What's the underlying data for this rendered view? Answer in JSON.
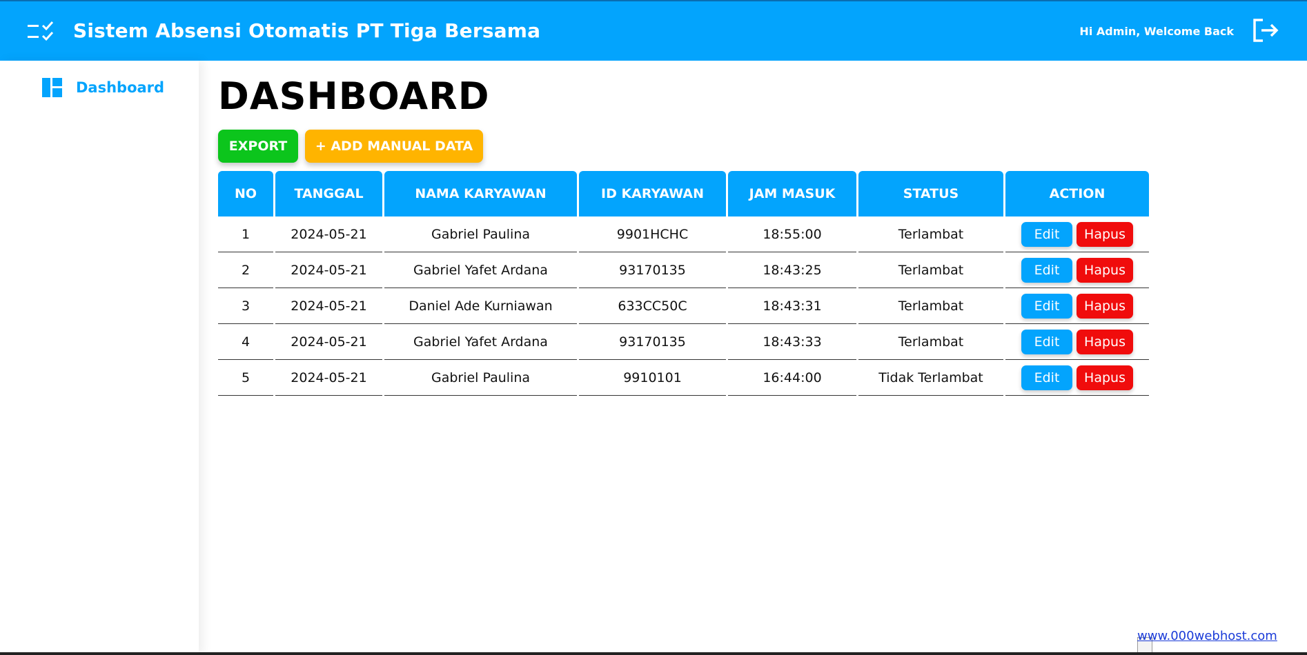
{
  "header": {
    "title": "Sistem Absensi Otomatis PT Tiga Bersama",
    "welcome": "Hi Admin, Welcome Back",
    "menu_icon": "checklist-icon",
    "logout_icon": "logout-icon"
  },
  "sidebar": {
    "items": [
      {
        "label": "Dashboard",
        "icon": "dashboard-icon"
      }
    ]
  },
  "main": {
    "title": "DASHBOARD",
    "export_label": "EXPORT",
    "add_label": "+ ADD MANUAL DATA"
  },
  "table": {
    "headers": [
      "NO",
      "TANGGAL",
      "NAMA KARYAWAN",
      "ID KARYAWAN",
      "JAM MASUK",
      "STATUS",
      "ACTION"
    ],
    "rows": [
      {
        "no": "1",
        "tanggal": "2024-05-21",
        "nama": "Gabriel Paulina",
        "id": "9901HCHC",
        "jam": "18:55:00",
        "status": "Terlambat"
      },
      {
        "no": "2",
        "tanggal": "2024-05-21",
        "nama": "Gabriel Yafet Ardana",
        "id": "93170135",
        "jam": "18:43:25",
        "status": "Terlambat"
      },
      {
        "no": "3",
        "tanggal": "2024-05-21",
        "nama": "Daniel Ade Kurniawan",
        "id": "633CC50C",
        "jam": "18:43:31",
        "status": "Terlambat"
      },
      {
        "no": "4",
        "tanggal": "2024-05-21",
        "nama": "Gabriel Yafet Ardana",
        "id": "93170135",
        "jam": "18:43:33",
        "status": "Terlambat"
      },
      {
        "no": "5",
        "tanggal": "2024-05-21",
        "nama": "Gabriel Paulina",
        "id": "9910101",
        "jam": "16:44:00",
        "status": "Tidak Terlambat"
      }
    ],
    "edit_label": "Edit",
    "delete_label": "Hapus"
  },
  "footer": {
    "link": "www.000webhost.com"
  },
  "colors": {
    "primary": "#03a4fd",
    "export": "#0cc51c",
    "add": "#ffb400",
    "delete": "#f00c0c"
  }
}
